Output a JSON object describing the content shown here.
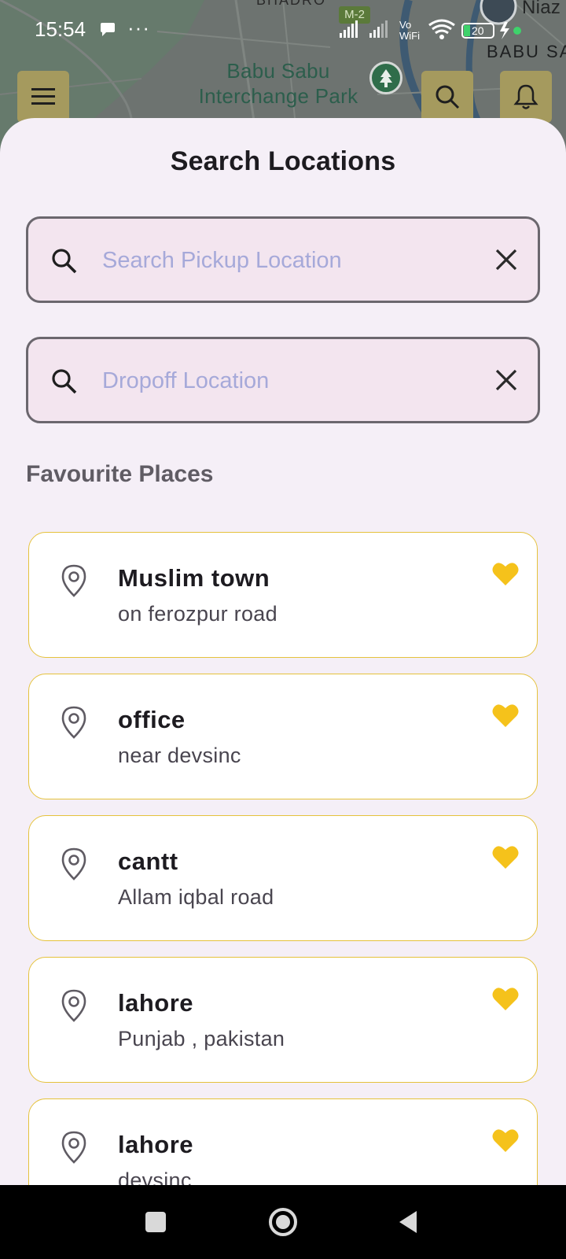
{
  "status_bar": {
    "time": "15:54",
    "dots": "···",
    "vowifi": "Vo\nWiFi",
    "battery": "20"
  },
  "map": {
    "top_label": "BHADRO",
    "badge": "M-2",
    "park_label": "Babu Sabu\nInterchange Park",
    "area_label": "BABU SA",
    "niaz_label": "Niaz"
  },
  "sheet": {
    "title": "Search Locations",
    "pickup": {
      "value": "",
      "placeholder": "Search Pickup Location"
    },
    "dropoff": {
      "value": "",
      "placeholder": "Dropoff Location"
    },
    "favourites_title": "Favourite Places",
    "places": [
      {
        "name": "Muslim town",
        "address": "on ferozpur road"
      },
      {
        "name": "office",
        "address": "near devsinc"
      },
      {
        "name": "cantt",
        "address": "Allam iqbal road"
      },
      {
        "name": "lahore",
        "address": "Punjab , pakistan"
      },
      {
        "name": "lahore",
        "address": "devsinc"
      }
    ]
  },
  "colors": {
    "accent_yellow": "#f5c21b",
    "card_border": "#e5c23c",
    "placeholder": "#a6a9d9",
    "sheet_bg": "#f5eff7"
  },
  "icons": {
    "menu": "menu-icon",
    "search": "search-icon",
    "bell": "bell-icon",
    "pin": "location-pin-icon",
    "heart": "heart-icon",
    "clear": "close-icon"
  }
}
